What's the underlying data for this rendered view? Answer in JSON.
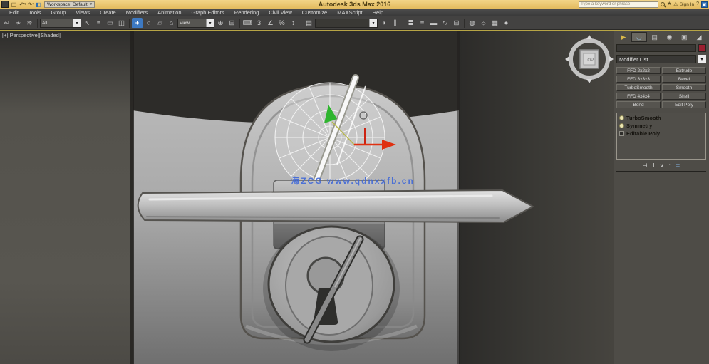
{
  "title_bar": {
    "title": "Autodesk 3ds Max 2016",
    "workspace_dropdown": "Workspace: Default",
    "qat_icons": [
      {
        "name": "save-icon",
        "glyph": "◫"
      },
      {
        "name": "undo-icon",
        "glyph": "↶"
      },
      {
        "name": "redo-icon",
        "glyph": "↷"
      },
      {
        "name": "workspace-icon",
        "glyph": "◧"
      }
    ],
    "infocenter": {
      "search_placeholder": "Type a keyword or phrase",
      "sign_in_label": "Sign In",
      "favorites_glyph": "★",
      "a360_glyph": "△",
      "help_glyph": "?"
    }
  },
  "menu_bar": {
    "items": [
      "Edit",
      "Tools",
      "Group",
      "Views",
      "Create",
      "Modifiers",
      "Animation",
      "Graph Editors",
      "Rendering",
      "Civil View",
      "Customize",
      "MAXScript",
      "Help"
    ]
  },
  "toolbar": {
    "selection_filter_value": "All",
    "coordinate_system_value": "View",
    "named_selection_value": "",
    "caret": "▾",
    "icons": [
      {
        "name": "select-and-link-icon",
        "glyph": "∾"
      },
      {
        "name": "unlink-selection-icon",
        "glyph": "≁"
      },
      {
        "name": "bind-to-space-warp-icon",
        "glyph": "≋"
      },
      {
        "name": "select-object-icon",
        "glyph": "↖"
      },
      {
        "name": "select-by-name-icon",
        "glyph": "≡"
      },
      {
        "name": "rectangular-selection-region-icon",
        "glyph": "▭"
      },
      {
        "name": "window-crossing-toggle-icon",
        "glyph": "◫"
      },
      {
        "name": "select-and-move-icon",
        "glyph": "+"
      },
      {
        "name": "select-and-rotate-icon",
        "glyph": "○"
      },
      {
        "name": "select-and-scale-icon",
        "glyph": "▱"
      },
      {
        "name": "select-and-place-icon",
        "glyph": "⌂"
      },
      {
        "name": "use-pivot-point-center-icon",
        "glyph": "⊕"
      },
      {
        "name": "select-and-manipulate-icon",
        "glyph": "⊞"
      },
      {
        "name": "keyboard-shortcut-override-icon",
        "glyph": "⌨"
      },
      {
        "name": "snaps-toggle-icon",
        "glyph": "3"
      },
      {
        "name": "angle-snap-toggle-icon",
        "glyph": "∠"
      },
      {
        "name": "percent-snap-toggle-icon",
        "glyph": "%"
      },
      {
        "name": "spinner-snap-toggle-icon",
        "glyph": "↕"
      },
      {
        "name": "edit-named-selection-sets-icon",
        "glyph": "▤"
      },
      {
        "name": "mirror-icon",
        "glyph": "◑"
      },
      {
        "name": "align-icon",
        "glyph": "∥"
      },
      {
        "name": "toggle-scene-explorer-icon",
        "glyph": "≣"
      },
      {
        "name": "toggle-layer-explorer-icon",
        "glyph": "≡"
      },
      {
        "name": "toggle-ribbon-icon",
        "glyph": "▬"
      },
      {
        "name": "curve-editor-icon",
        "glyph": "∿"
      },
      {
        "name": "schematic-view-icon",
        "glyph": "⊟"
      },
      {
        "name": "material-editor-icon",
        "glyph": "◍"
      },
      {
        "name": "render-setup-icon",
        "glyph": "☼"
      },
      {
        "name": "rendered-frame-window-icon",
        "glyph": "▦"
      },
      {
        "name": "render-production-icon",
        "glyph": "●"
      }
    ]
  },
  "viewport": {
    "label": "[+][Perspective][Shaded]",
    "watermark": "海ZCG www.qdnxxfb.cn",
    "viewcube_face": "TOP"
  },
  "command_panel": {
    "tabs": [
      {
        "name": "create-tab",
        "glyph": "▶"
      },
      {
        "name": "modify-tab",
        "glyph": "◡"
      },
      {
        "name": "hierarchy-tab",
        "glyph": "▤"
      },
      {
        "name": "motion-tab",
        "glyph": "◉"
      },
      {
        "name": "display-tab",
        "glyph": "▣"
      },
      {
        "name": "utilities-tab",
        "glyph": "◢"
      }
    ],
    "object_name_value": "",
    "object_color": "#9b1f30",
    "modifier_list_label": "Modifier List",
    "modifier_buttons": [
      "FFD 2x2x2",
      "Extrude",
      "FFD 3x3x3",
      "Bevel",
      "TurboSmooth",
      "Smooth",
      "FFD 4x4x4",
      "Shell",
      "Bend",
      "Edit Poly"
    ],
    "modifier_stack": [
      {
        "label": "TurboSmooth"
      },
      {
        "label": "Symmetry"
      },
      {
        "label": "Editable Poly"
      }
    ],
    "stack_tools": [
      {
        "name": "pin-stack-icon",
        "glyph": "⊣"
      },
      {
        "name": "show-end-result-icon",
        "glyph": "‖"
      },
      {
        "name": "make-unique-icon",
        "glyph": "∨"
      },
      {
        "name": "remove-modifier-icon",
        "glyph": ":"
      },
      {
        "name": "configure-modifier-sets-icon",
        "glyph": "≣"
      }
    ]
  },
  "colors": {
    "titlebar_tan": "#e7c36a",
    "active_tool_blue": "#3d79c2",
    "viewport_border_yellow": "#b7a545",
    "gizmo_x_red": "#e03010",
    "gizmo_y_green": "#2fb52f",
    "watermark_blue": "#4169d8"
  }
}
